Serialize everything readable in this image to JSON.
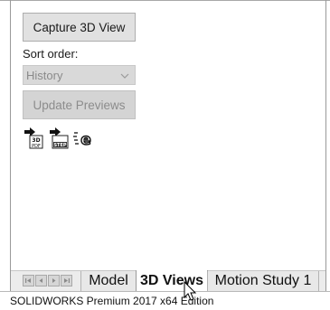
{
  "panel": {
    "capture_label": "Capture 3D View",
    "sort_label": "Sort order:",
    "sort_value": "History",
    "update_label": "Update Previews",
    "icons": [
      {
        "name": "publish-3d-pdf-icon",
        "text": "3D\nPDF"
      },
      {
        "name": "publish-step-icon",
        "text": "STEP"
      },
      {
        "name": "publish-edrawings-icon",
        "text": "e"
      }
    ]
  },
  "tabs": {
    "model": "Model",
    "views3d": "3D Views",
    "motion": "Motion Study 1"
  },
  "status": {
    "text": "SOLIDWORKS Premium 2017 x64 Edition"
  },
  "colors": {
    "button_face": "#e1e1e1",
    "disabled_text": "#8c8c8c",
    "active_tab": "#ffffff"
  }
}
